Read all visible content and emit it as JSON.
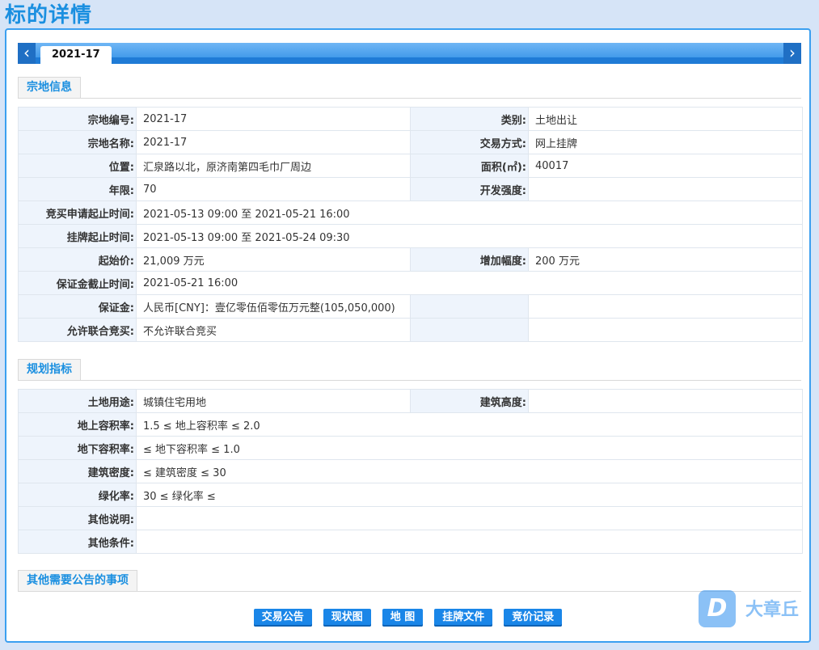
{
  "page_title": "标的详情",
  "tabs": {
    "active": "2021-17",
    "prev_icon": "chevron-left-icon",
    "next_icon": "chevron-right-icon"
  },
  "sections": {
    "land_info": "宗地信息",
    "planning": "规划指标",
    "other": "其他需要公告的事项"
  },
  "land_info": {
    "parcel_no_label": "宗地编号:",
    "parcel_no": "2021-17",
    "category_label": "类别:",
    "category": "土地出让",
    "parcel_name_label": "宗地名称:",
    "parcel_name": "2021-17",
    "trade_mode_label": "交易方式:",
    "trade_mode": "网上挂牌",
    "location_label": "位置:",
    "location": "汇泉路以北，原济南第四毛巾厂周边",
    "area_label": "面积(㎡):",
    "area": "40017",
    "years_label": "年限:",
    "years": "70",
    "intensity_label": "开发强度:",
    "intensity": "",
    "bid_apply_label": "竞买申请起止时间:",
    "bid_apply": "2021-05-13 09:00 至 2021-05-21 16:00",
    "listing_label": "挂牌起止时间:",
    "listing": "2021-05-13 09:00 至 2021-05-24 09:30",
    "start_price_label": "起始价:",
    "start_price": "21,009 万元",
    "increment_label": "增加幅度:",
    "increment": "200 万元",
    "deposit_deadline_label": "保证金截止时间:",
    "deposit_deadline": "2021-05-21 16:00",
    "deposit_label": "保证金:",
    "deposit": "人民币[CNY]：壹亿零伍佰零伍万元整(105,050,000)",
    "joint_bid_label": "允许联合竞买:",
    "joint_bid": "不允许联合竞买"
  },
  "planning": {
    "land_use_label": "土地用途:",
    "land_use": "城镇住宅用地",
    "building_height_label": "建筑高度:",
    "building_height": "",
    "far_above_label": "地上容积率:",
    "far_above": "1.5 ≤ 地上容积率 ≤ 2.0",
    "far_below_label": "地下容积率:",
    "far_below": "≤ 地下容积率 ≤ 1.0",
    "density_label": "建筑密度:",
    "density": "≤ 建筑密度 ≤ 30",
    "green_label": "绿化率:",
    "green": "30 ≤ 绿化率 ≤",
    "other_desc_label": "其他说明:",
    "other_desc": "",
    "other_cond_label": "其他条件:",
    "other_cond": ""
  },
  "buttons": [
    "交易公告",
    "现状图",
    "地 图",
    "挂牌文件",
    "竞价记录"
  ],
  "watermark": {
    "badge": "D",
    "text": "大章丘"
  }
}
